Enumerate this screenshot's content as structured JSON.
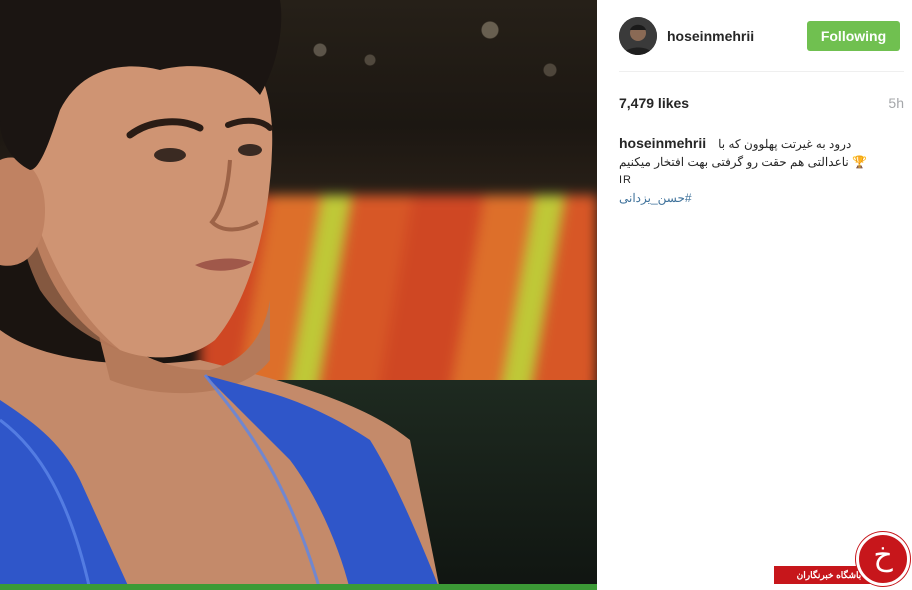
{
  "post": {
    "username": "hoseinmehrii",
    "follow_label": "Following",
    "likes": "7,479 likes",
    "time": "5h",
    "caption": {
      "username": "hoseinmehrii",
      "line1": "درود به غیرتت پهلوون که با",
      "line2": "ناعدالتی هم حقت رو گرفتی بهت افتخار میکنیم",
      "line2_emoji": "🏆",
      "line3": "IR",
      "hashtag": "#حسن_یزدانی"
    }
  },
  "watermark": {
    "logo_letter": "خ",
    "text": "باشگاه خبرنگاران"
  },
  "colors": {
    "follow_green": "#70c050",
    "hashtag_blue": "#3f729b",
    "watermark_red": "#c7161b",
    "singlet_blue": "#2f56c9"
  }
}
